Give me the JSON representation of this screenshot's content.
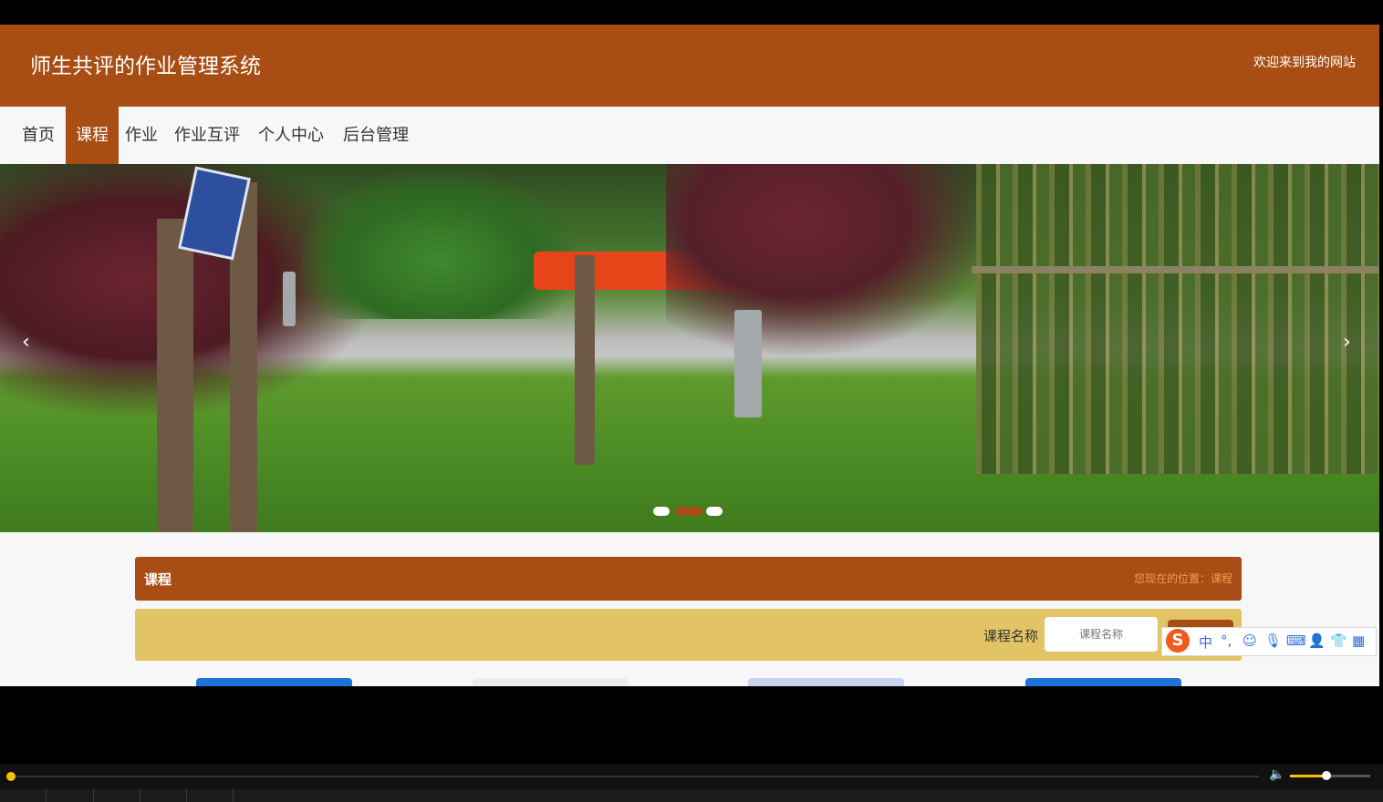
{
  "header": {
    "title": "师生共评的作业管理系统",
    "welcome": "欢迎来到我的网站"
  },
  "nav": {
    "items": [
      "首页",
      "课程",
      "作业",
      "作业互评",
      "个人中心",
      "后台管理"
    ],
    "active": "课程"
  },
  "banner": {
    "prev": "‹",
    "next": "›",
    "slide_count": 3,
    "active_slide": 2
  },
  "section": {
    "title": "课程",
    "breadcrumb": "您现在的位置：课程"
  },
  "search": {
    "label": "课程名称",
    "placeholder": "课程名称"
  },
  "ime": {
    "logo": "S",
    "items": [
      "中",
      "°,",
      "☺",
      "🎙",
      "⌨",
      "👤",
      "👕",
      "▦"
    ]
  },
  "colors": {
    "brand": "#a84d14",
    "search_bg": "#e2c464",
    "accent": "#f5c400"
  },
  "player": {
    "progress": 0.0,
    "volume": 0.45
  }
}
